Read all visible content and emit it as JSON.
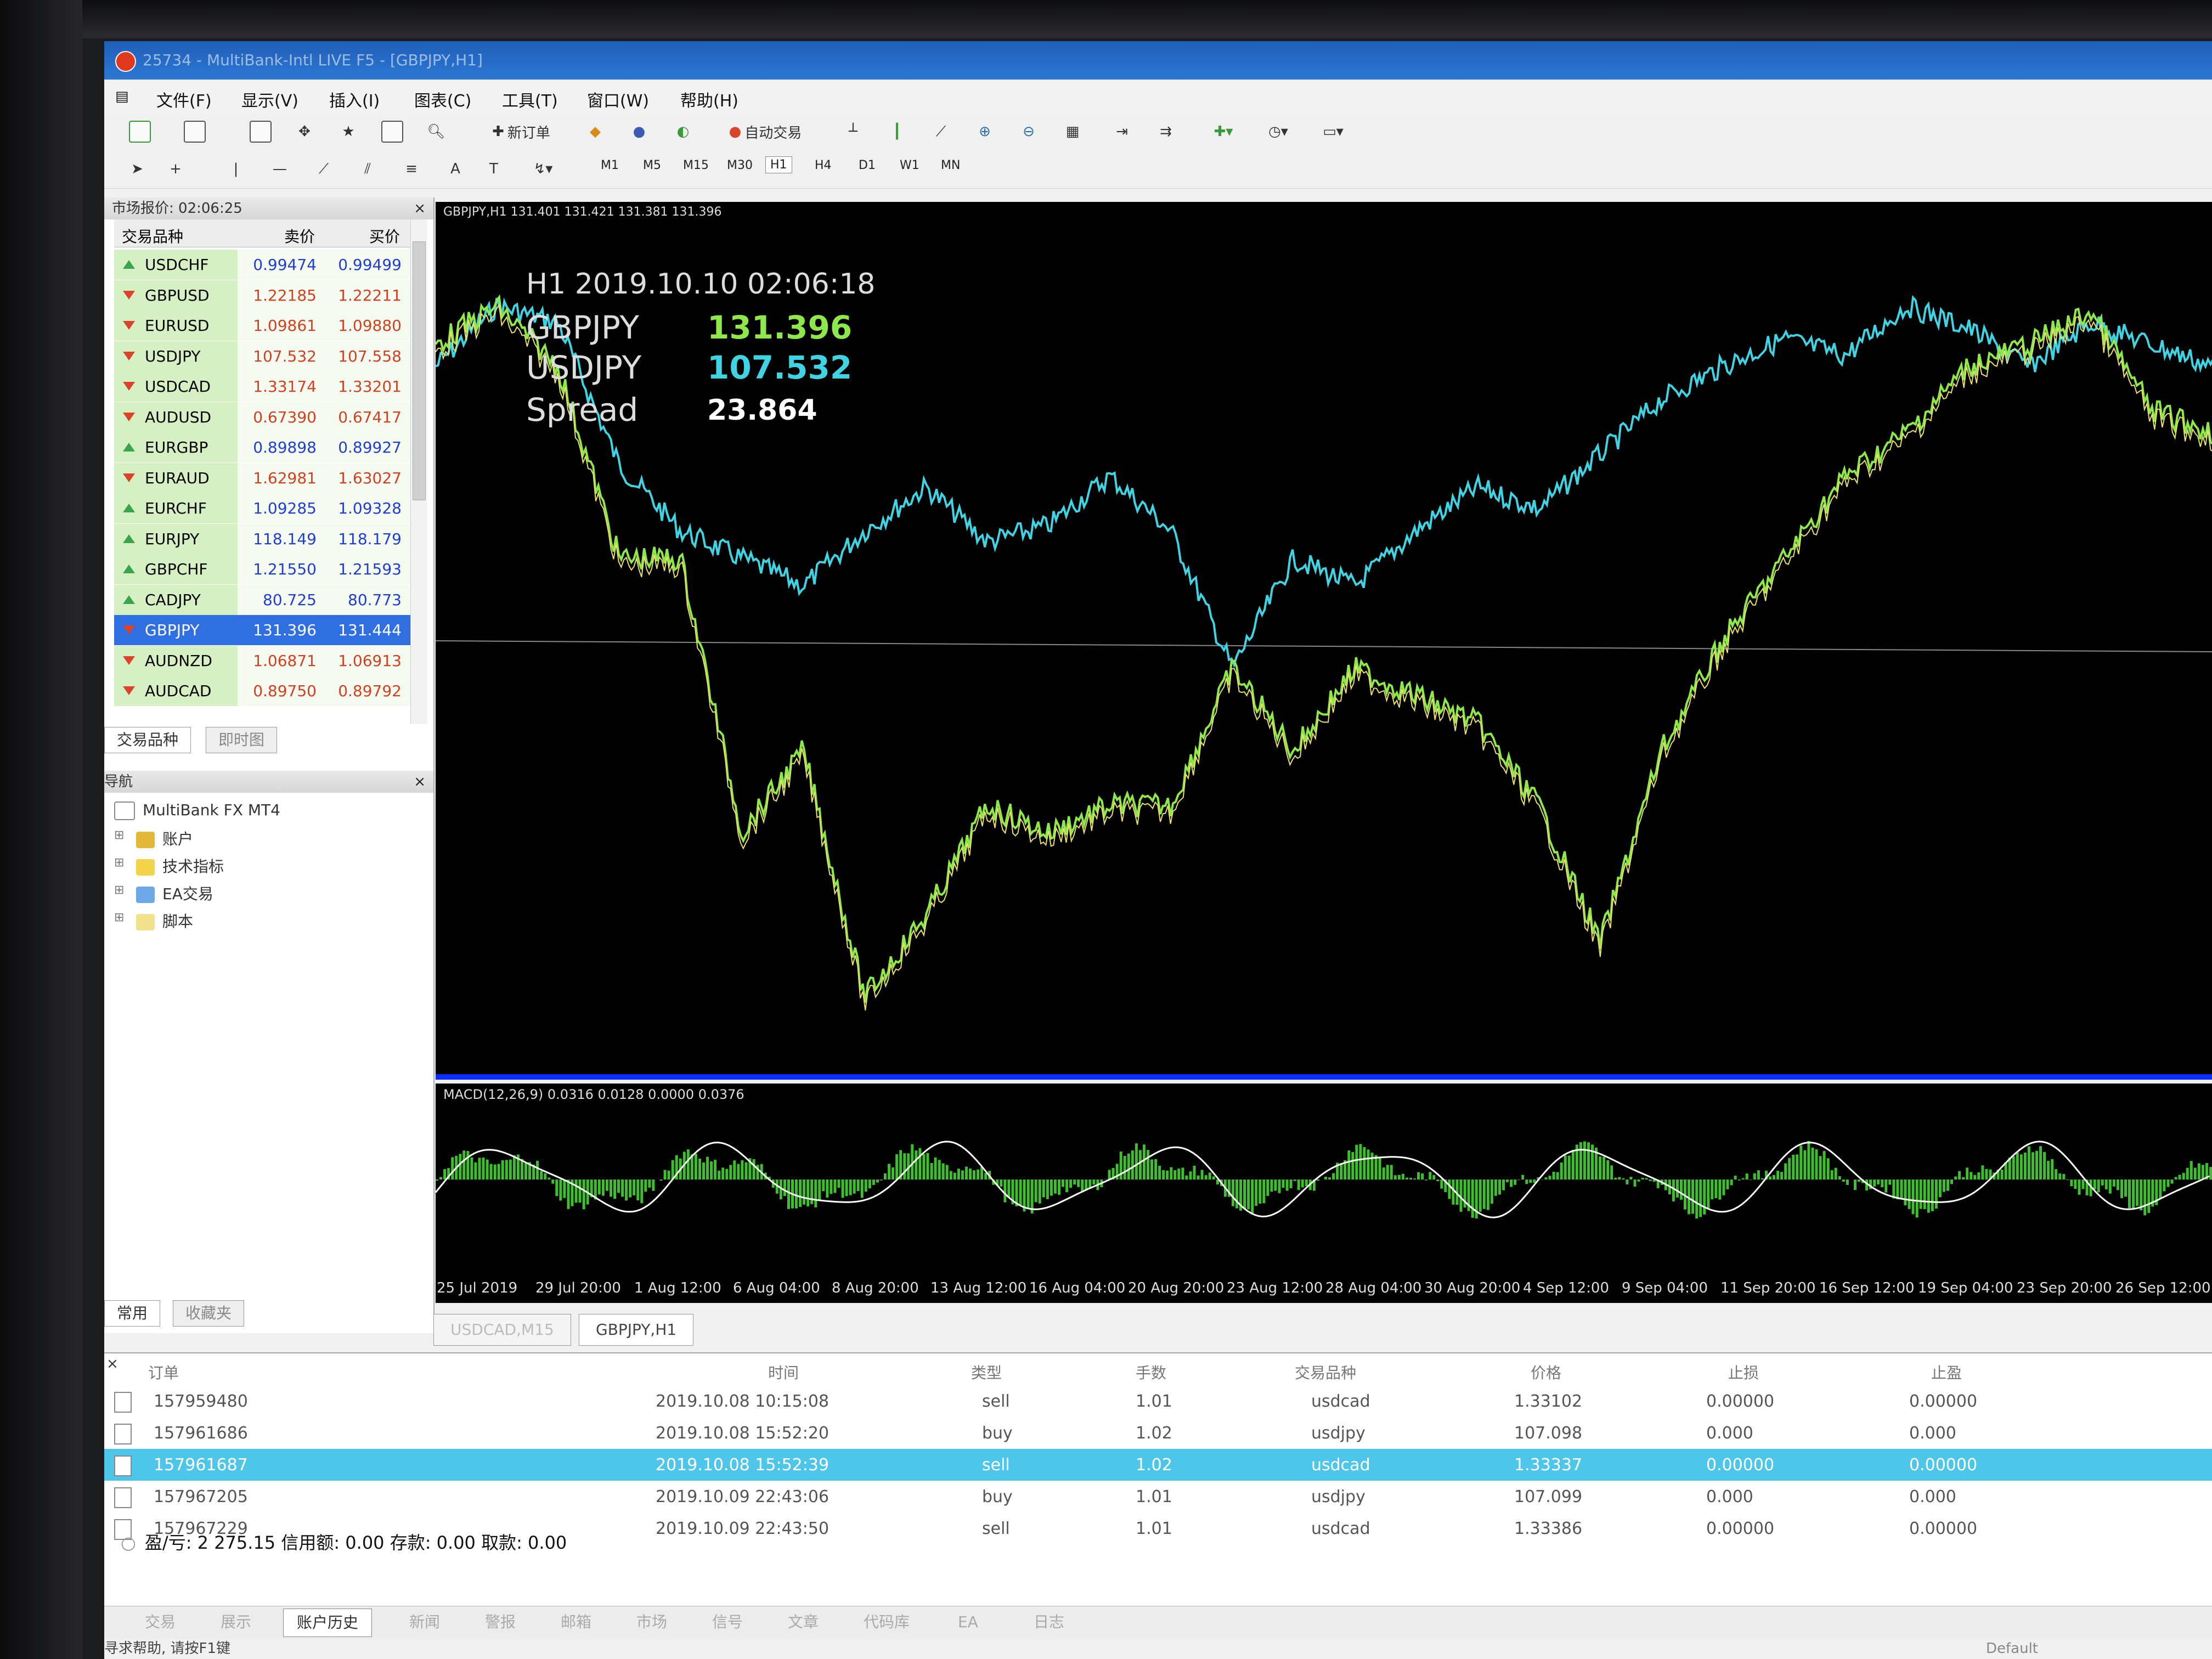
{
  "window": {
    "title": "25734 - MultiBank-Intl LIVE F5 - [GBPJPY,H1]"
  },
  "menu": [
    "文件(F)",
    "显示(V)",
    "插入(I)",
    "图表(C)",
    "工具(T)",
    "窗口(W)",
    "帮助(H)"
  ],
  "toolbar": {
    "new_order": "新订单",
    "auto_trade": "自动交易",
    "timeframes": [
      "M1",
      "M5",
      "M15",
      "M30",
      "H1",
      "H4",
      "D1",
      "W1",
      "MN"
    ],
    "active_tf": "H1"
  },
  "market_watch": {
    "title": "市场报价: 02:06:25",
    "col_symbol": "交易品种",
    "col_bid": "卖价",
    "col_ask": "买价",
    "rows": [
      {
        "symbol": "USDCHF",
        "bid": "0.99474",
        "ask": "0.99499",
        "dir": "up",
        "color": "blue"
      },
      {
        "symbol": "GBPUSD",
        "bid": "1.22185",
        "ask": "1.22211",
        "dir": "down",
        "color": "red"
      },
      {
        "symbol": "EURUSD",
        "bid": "1.09861",
        "ask": "1.09880",
        "dir": "down",
        "color": "red"
      },
      {
        "symbol": "USDJPY",
        "bid": "107.532",
        "ask": "107.558",
        "dir": "down",
        "color": "red"
      },
      {
        "symbol": "USDCAD",
        "bid": "1.33174",
        "ask": "1.33201",
        "dir": "down",
        "color": "red"
      },
      {
        "symbol": "AUDUSD",
        "bid": "0.67390",
        "ask": "0.67417",
        "dir": "down",
        "color": "red"
      },
      {
        "symbol": "EURGBP",
        "bid": "0.89898",
        "ask": "0.89927",
        "dir": "up",
        "color": "blue"
      },
      {
        "symbol": "EURAUD",
        "bid": "1.62981",
        "ask": "1.63027",
        "dir": "down",
        "color": "red"
      },
      {
        "symbol": "EURCHF",
        "bid": "1.09285",
        "ask": "1.09328",
        "dir": "up",
        "color": "blue"
      },
      {
        "symbol": "EURJPY",
        "bid": "118.149",
        "ask": "118.179",
        "dir": "up",
        "color": "blue"
      },
      {
        "symbol": "GBPCHF",
        "bid": "1.21550",
        "ask": "1.21593",
        "dir": "up",
        "color": "blue"
      },
      {
        "symbol": "CADJPY",
        "bid": "80.725",
        "ask": "80.773",
        "dir": "up",
        "color": "blue"
      },
      {
        "symbol": "GBPJPY",
        "bid": "131.396",
        "ask": "131.444",
        "dir": "down",
        "color": "sel"
      },
      {
        "symbol": "AUDNZD",
        "bid": "1.06871",
        "ask": "1.06913",
        "dir": "down",
        "color": "red"
      },
      {
        "symbol": "AUDCAD",
        "bid": "0.89750",
        "ask": "0.89792",
        "dir": "down",
        "color": "red"
      }
    ],
    "tab_symbols": "交易品种",
    "tab_tick": "即时图"
  },
  "navigator": {
    "title": "导航",
    "root": "MultiBank FX MT4",
    "items": [
      "账户",
      "技术指标",
      "EA交易",
      "脚本"
    ],
    "tab_common": "常用",
    "tab_fav": "收藏夹"
  },
  "chart": {
    "header": "GBPJPY,H1  131.401 131.421 131.381 131.396",
    "overlay_time": "H1  2019.10.10 02:06:18",
    "sym1": "GBPJPY",
    "val1": "131.396",
    "sym2": "USDJPY",
    "val2": "107.532",
    "spread_label": "Spread",
    "spread_val": "23.864",
    "macd_label": "MACD(12,26,9) 0.0316 0.0128 0.0000 0.0376",
    "xticks": [
      "25 Jul 2019",
      "29 Jul 20:00",
      "1 Aug 12:00",
      "6 Aug 04:00",
      "8 Aug 20:00",
      "13 Aug 12:00",
      "16 Aug 04:00",
      "20 Aug 20:00",
      "23 Aug 12:00",
      "28 Aug 04:00",
      "30 Aug 20:00",
      "4 Sep 12:00",
      "9 Sep 04:00",
      "11 Sep 20:00",
      "16 Sep 12:00",
      "19 Sep 04:00",
      "23 Sep 20:00",
      "26 Sep 12:00"
    ],
    "colors": {
      "gbpjpy": "#8ee84a",
      "usdjpy": "#3fd4e4",
      "macd_hist": "#3fbf2f",
      "signal": "#ffffff"
    }
  },
  "chart_tabs": [
    "USDCAD,M15",
    "GBPJPY,H1"
  ],
  "terminal": {
    "headers": [
      "订单",
      "时间",
      "类型",
      "手数",
      "交易品种",
      "价格",
      "止损",
      "止盈"
    ],
    "rows": [
      {
        "order": "157959480",
        "time": "2019.10.08 10:15:08",
        "type": "sell",
        "lots": "1.01",
        "symbol": "usdcad",
        "price": "1.33102",
        "sl": "0.00000",
        "tp": "0.00000"
      },
      {
        "order": "157961686",
        "time": "2019.10.08 15:52:20",
        "type": "buy",
        "lots": "1.02",
        "symbol": "usdjpy",
        "price": "107.098",
        "sl": "0.000",
        "tp": "0.000"
      },
      {
        "order": "157961687",
        "time": "2019.10.08 15:52:39",
        "type": "sell",
        "lots": "1.02",
        "symbol": "usdcad",
        "price": "1.33337",
        "sl": "0.00000",
        "tp": "0.00000"
      },
      {
        "order": "157967205",
        "time": "2019.10.09 22:43:06",
        "type": "buy",
        "lots": "1.01",
        "symbol": "usdjpy",
        "price": "107.099",
        "sl": "0.000",
        "tp": "0.000"
      },
      {
        "order": "157967229",
        "time": "2019.10.09 22:43:50",
        "type": "sell",
        "lots": "1.01",
        "symbol": "usdcad",
        "price": "1.33386",
        "sl": "0.00000",
        "tp": "0.00000"
      }
    ],
    "summary": "盈/亏: 2 275.15  信用额: 0.00  存款: 0.00  取款: 0.00",
    "tabs": [
      "交易",
      "展示",
      "账户历史",
      "新闻",
      "警报",
      "邮箱",
      "市场",
      "信号",
      "文章",
      "代码库",
      "EA",
      "日志"
    ],
    "active_tab": "账户历史"
  },
  "status": {
    "help": "寻求帮助, 请按F1键",
    "profile": "Default"
  }
}
